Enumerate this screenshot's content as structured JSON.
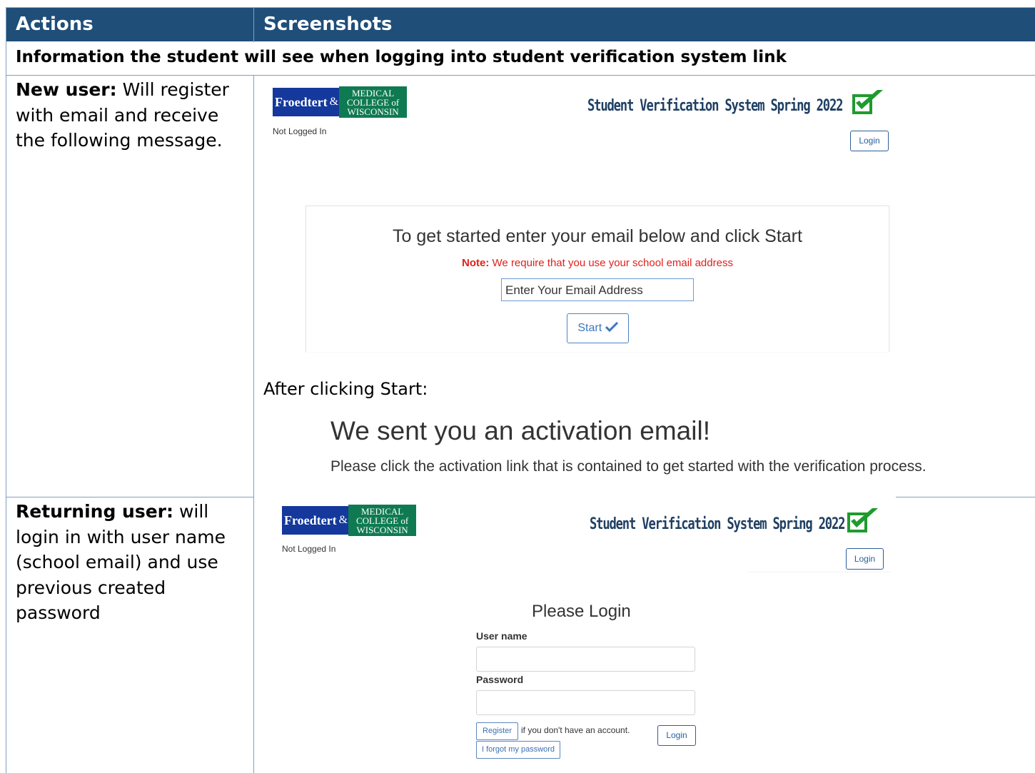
{
  "table": {
    "header": {
      "col_actions": "Actions",
      "col_screenshots": "Screenshots"
    },
    "intro": "Information the student will see when logging into student verification system link"
  },
  "rows": {
    "new_user": {
      "label": "New user:",
      "text": " Will register with email and receive the following message."
    },
    "returning_user": {
      "label": "Returning user:",
      "text": " will login in with user name (school email) and use previous created password"
    }
  },
  "brand": {
    "froedtert": "Froedtert",
    "amp": "&",
    "mcw_line1": "MEDICAL",
    "mcw_line2": "COLLEGE of",
    "mcw_line3": "WISCONSIN",
    "system_title": "Student Verification System Spring 2022"
  },
  "register_panel": {
    "status": "Not Logged In",
    "login_button": "Login",
    "heading": "To get started enter your email below and click Start",
    "note_label": "Note:",
    "note_text": " We require that you use your school email address",
    "email_value": "Enter Your Email Address",
    "start_button": "Start",
    "after_text": "After clicking Start:",
    "sent_heading": "We sent you an activation email!",
    "sent_text": "Please click the activation link that is contained to get started with the verification process."
  },
  "login_panel": {
    "status": "Not Logged In",
    "login_button": "Login",
    "heading": "Please Login",
    "username_label": "User name",
    "password_label": "Password",
    "register_button": "Register",
    "register_hint": "if you don't have an account.",
    "submit_button": "Login",
    "forgot_button": "I forgot my password"
  },
  "colors": {
    "header_bg": "#1f4e79",
    "note_red": "#e0201b",
    "check_green": "#1e9b2e",
    "title_navy": "#1f3f63"
  },
  "icons": {
    "check": "checkmark-icon",
    "start_check": "check-icon"
  }
}
